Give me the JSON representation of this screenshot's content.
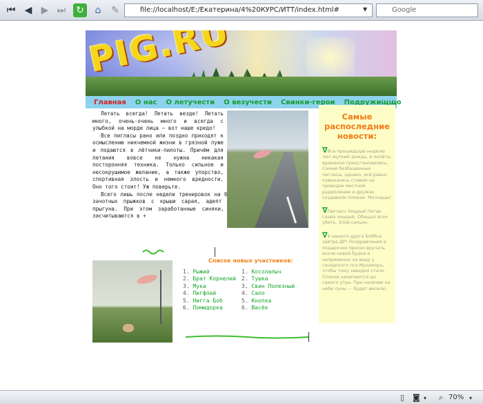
{
  "browser": {
    "address": "file://localhost/E:/Екатерина/4%20КУРС/ИТТ/index.html#",
    "search_placeholder": "Google",
    "zoom": "70%"
  },
  "site": {
    "logo_text": "PIG.RU",
    "nav": [
      "Главная",
      "О нас",
      "О летучести",
      "О везучести",
      "Свинки-герои",
      "Подружищщо"
    ]
  },
  "article": {
    "paragraphs": [
      "Летать всегда! Летать везде! Летать много, очень-очень много и всегда с улыбкой на морде лица — вот наше кредо!",
      "Все пигласы рано или поздно приходят к осмыслению никчемной жизни в грязной луже и подаются в лётчики-пилоты. Причём для летания вовсе не нужна никакая посторонняя техника. Только сильное и несокрушимое желание, а также упорство, спортивная злость и немного вредности. Оно того стоит! Уж поверьте.",
      "Всего лишь после недели тренировок на брезентовом батуте и трёх зачотных прыжков с крыши сарая, адепт получает звание летуна-прыгуна. При этом заработанные синяки, ссадины и шишки также засчитываются в +"
    ]
  },
  "sidebar": {
    "heading": "Самые распоследние новости:",
    "news": [
      "Все прошедшую неделю лил жуткий дождь, и полёты временно приостановились. Самые безбашенные пигласы, однако, всё равно кувыкались ставим на проводах местной радиолинии и дружно создавали помехи. Молодцы!",
      "Пигласс Хмурый Пятак снова хмурый. Обещал всех убить. Злой сильно.",
      "У нашего друга Боббса завтра ДР! Поздравления и подарочки просил вручать возле новой будки и непременно на виду у соседского пса Мухомора, чтобы тому завидно стало. Пляски намечаются до самого утра. При наличии на небе луны — будет веселю."
    ]
  },
  "members": {
    "title": "Список новых участников:",
    "list1": [
      "Рыжий",
      "Брат Корнелий",
      "Мука",
      "Пигфлай",
      "Нигга Боб",
      "Помидорка"
    ],
    "list2": [
      "Косолапыч",
      "Тушка",
      "Свин Полезный",
      "Сало",
      "Кнопка",
      "Васёк"
    ]
  },
  "colors": {
    "nav_bg": "#8dd3ee",
    "nav_link": "#169c2e",
    "nav_active": "#d42121",
    "sidebar_bg": "#fdfdc8",
    "accent_orange": "#f27a16"
  }
}
